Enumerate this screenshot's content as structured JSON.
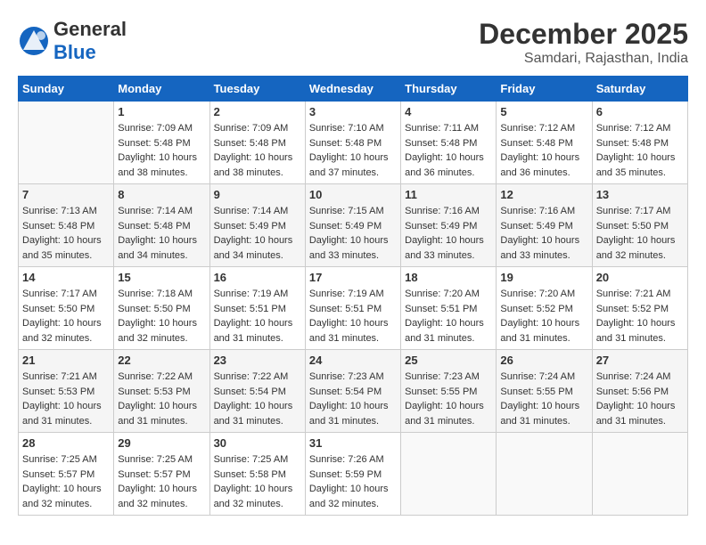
{
  "logo": {
    "general": "General",
    "blue": "Blue"
  },
  "title": "December 2025",
  "subtitle": "Samdari, Rajasthan, India",
  "headers": [
    "Sunday",
    "Monday",
    "Tuesday",
    "Wednesday",
    "Thursday",
    "Friday",
    "Saturday"
  ],
  "weeks": [
    [
      {
        "day": "",
        "sunrise": "",
        "sunset": "",
        "daylight": ""
      },
      {
        "day": "1",
        "sunrise": "Sunrise: 7:09 AM",
        "sunset": "Sunset: 5:48 PM",
        "daylight": "Daylight: 10 hours and 38 minutes."
      },
      {
        "day": "2",
        "sunrise": "Sunrise: 7:09 AM",
        "sunset": "Sunset: 5:48 PM",
        "daylight": "Daylight: 10 hours and 38 minutes."
      },
      {
        "day": "3",
        "sunrise": "Sunrise: 7:10 AM",
        "sunset": "Sunset: 5:48 PM",
        "daylight": "Daylight: 10 hours and 37 minutes."
      },
      {
        "day": "4",
        "sunrise": "Sunrise: 7:11 AM",
        "sunset": "Sunset: 5:48 PM",
        "daylight": "Daylight: 10 hours and 36 minutes."
      },
      {
        "day": "5",
        "sunrise": "Sunrise: 7:12 AM",
        "sunset": "Sunset: 5:48 PM",
        "daylight": "Daylight: 10 hours and 36 minutes."
      },
      {
        "day": "6",
        "sunrise": "Sunrise: 7:12 AM",
        "sunset": "Sunset: 5:48 PM",
        "daylight": "Daylight: 10 hours and 35 minutes."
      }
    ],
    [
      {
        "day": "7",
        "sunrise": "Sunrise: 7:13 AM",
        "sunset": "Sunset: 5:48 PM",
        "daylight": "Daylight: 10 hours and 35 minutes."
      },
      {
        "day": "8",
        "sunrise": "Sunrise: 7:14 AM",
        "sunset": "Sunset: 5:48 PM",
        "daylight": "Daylight: 10 hours and 34 minutes."
      },
      {
        "day": "9",
        "sunrise": "Sunrise: 7:14 AM",
        "sunset": "Sunset: 5:49 PM",
        "daylight": "Daylight: 10 hours and 34 minutes."
      },
      {
        "day": "10",
        "sunrise": "Sunrise: 7:15 AM",
        "sunset": "Sunset: 5:49 PM",
        "daylight": "Daylight: 10 hours and 33 minutes."
      },
      {
        "day": "11",
        "sunrise": "Sunrise: 7:16 AM",
        "sunset": "Sunset: 5:49 PM",
        "daylight": "Daylight: 10 hours and 33 minutes."
      },
      {
        "day": "12",
        "sunrise": "Sunrise: 7:16 AM",
        "sunset": "Sunset: 5:49 PM",
        "daylight": "Daylight: 10 hours and 33 minutes."
      },
      {
        "day": "13",
        "sunrise": "Sunrise: 7:17 AM",
        "sunset": "Sunset: 5:50 PM",
        "daylight": "Daylight: 10 hours and 32 minutes."
      }
    ],
    [
      {
        "day": "14",
        "sunrise": "Sunrise: 7:17 AM",
        "sunset": "Sunset: 5:50 PM",
        "daylight": "Daylight: 10 hours and 32 minutes."
      },
      {
        "day": "15",
        "sunrise": "Sunrise: 7:18 AM",
        "sunset": "Sunset: 5:50 PM",
        "daylight": "Daylight: 10 hours and 32 minutes."
      },
      {
        "day": "16",
        "sunrise": "Sunrise: 7:19 AM",
        "sunset": "Sunset: 5:51 PM",
        "daylight": "Daylight: 10 hours and 31 minutes."
      },
      {
        "day": "17",
        "sunrise": "Sunrise: 7:19 AM",
        "sunset": "Sunset: 5:51 PM",
        "daylight": "Daylight: 10 hours and 31 minutes."
      },
      {
        "day": "18",
        "sunrise": "Sunrise: 7:20 AM",
        "sunset": "Sunset: 5:51 PM",
        "daylight": "Daylight: 10 hours and 31 minutes."
      },
      {
        "day": "19",
        "sunrise": "Sunrise: 7:20 AM",
        "sunset": "Sunset: 5:52 PM",
        "daylight": "Daylight: 10 hours and 31 minutes."
      },
      {
        "day": "20",
        "sunrise": "Sunrise: 7:21 AM",
        "sunset": "Sunset: 5:52 PM",
        "daylight": "Daylight: 10 hours and 31 minutes."
      }
    ],
    [
      {
        "day": "21",
        "sunrise": "Sunrise: 7:21 AM",
        "sunset": "Sunset: 5:53 PM",
        "daylight": "Daylight: 10 hours and 31 minutes."
      },
      {
        "day": "22",
        "sunrise": "Sunrise: 7:22 AM",
        "sunset": "Sunset: 5:53 PM",
        "daylight": "Daylight: 10 hours and 31 minutes."
      },
      {
        "day": "23",
        "sunrise": "Sunrise: 7:22 AM",
        "sunset": "Sunset: 5:54 PM",
        "daylight": "Daylight: 10 hours and 31 minutes."
      },
      {
        "day": "24",
        "sunrise": "Sunrise: 7:23 AM",
        "sunset": "Sunset: 5:54 PM",
        "daylight": "Daylight: 10 hours and 31 minutes."
      },
      {
        "day": "25",
        "sunrise": "Sunrise: 7:23 AM",
        "sunset": "Sunset: 5:55 PM",
        "daylight": "Daylight: 10 hours and 31 minutes."
      },
      {
        "day": "26",
        "sunrise": "Sunrise: 7:24 AM",
        "sunset": "Sunset: 5:55 PM",
        "daylight": "Daylight: 10 hours and 31 minutes."
      },
      {
        "day": "27",
        "sunrise": "Sunrise: 7:24 AM",
        "sunset": "Sunset: 5:56 PM",
        "daylight": "Daylight: 10 hours and 31 minutes."
      }
    ],
    [
      {
        "day": "28",
        "sunrise": "Sunrise: 7:25 AM",
        "sunset": "Sunset: 5:57 PM",
        "daylight": "Daylight: 10 hours and 32 minutes."
      },
      {
        "day": "29",
        "sunrise": "Sunrise: 7:25 AM",
        "sunset": "Sunset: 5:57 PM",
        "daylight": "Daylight: 10 hours and 32 minutes."
      },
      {
        "day": "30",
        "sunrise": "Sunrise: 7:25 AM",
        "sunset": "Sunset: 5:58 PM",
        "daylight": "Daylight: 10 hours and 32 minutes."
      },
      {
        "day": "31",
        "sunrise": "Sunrise: 7:26 AM",
        "sunset": "Sunset: 5:59 PM",
        "daylight": "Daylight: 10 hours and 32 minutes."
      },
      {
        "day": "",
        "sunrise": "",
        "sunset": "",
        "daylight": ""
      },
      {
        "day": "",
        "sunrise": "",
        "sunset": "",
        "daylight": ""
      },
      {
        "day": "",
        "sunrise": "",
        "sunset": "",
        "daylight": ""
      }
    ]
  ]
}
